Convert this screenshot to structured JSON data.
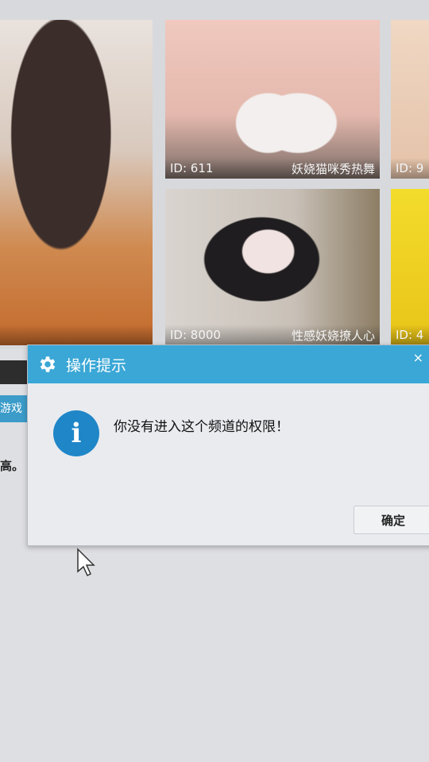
{
  "tiles": [
    {
      "id_label": "",
      "title": ""
    },
    {
      "id_label": "ID: 611",
      "title": "妖娆猫咪秀热舞"
    },
    {
      "id_label": "ID: 8000",
      "title": "性感妖娆撩人心"
    },
    {
      "id_label": "ID: 9",
      "title": ""
    },
    {
      "id_label": "ID: 4",
      "title": ""
    }
  ],
  "sidebar": {
    "tab_label": "游戏",
    "text_fragment": "高。"
  },
  "dialog": {
    "title": "操作提示",
    "message": "你没有进入这个频道的权限！",
    "ok_label": "确定",
    "close_label": "×"
  },
  "icons": {
    "header": "gear-icon",
    "message": "info-icon",
    "pointer": "mouse-cursor-icon"
  },
  "colors": {
    "header_bg": "#3aa7d6",
    "info_icon": "#1f86c8",
    "dialog_bg": "#e9ebef"
  }
}
